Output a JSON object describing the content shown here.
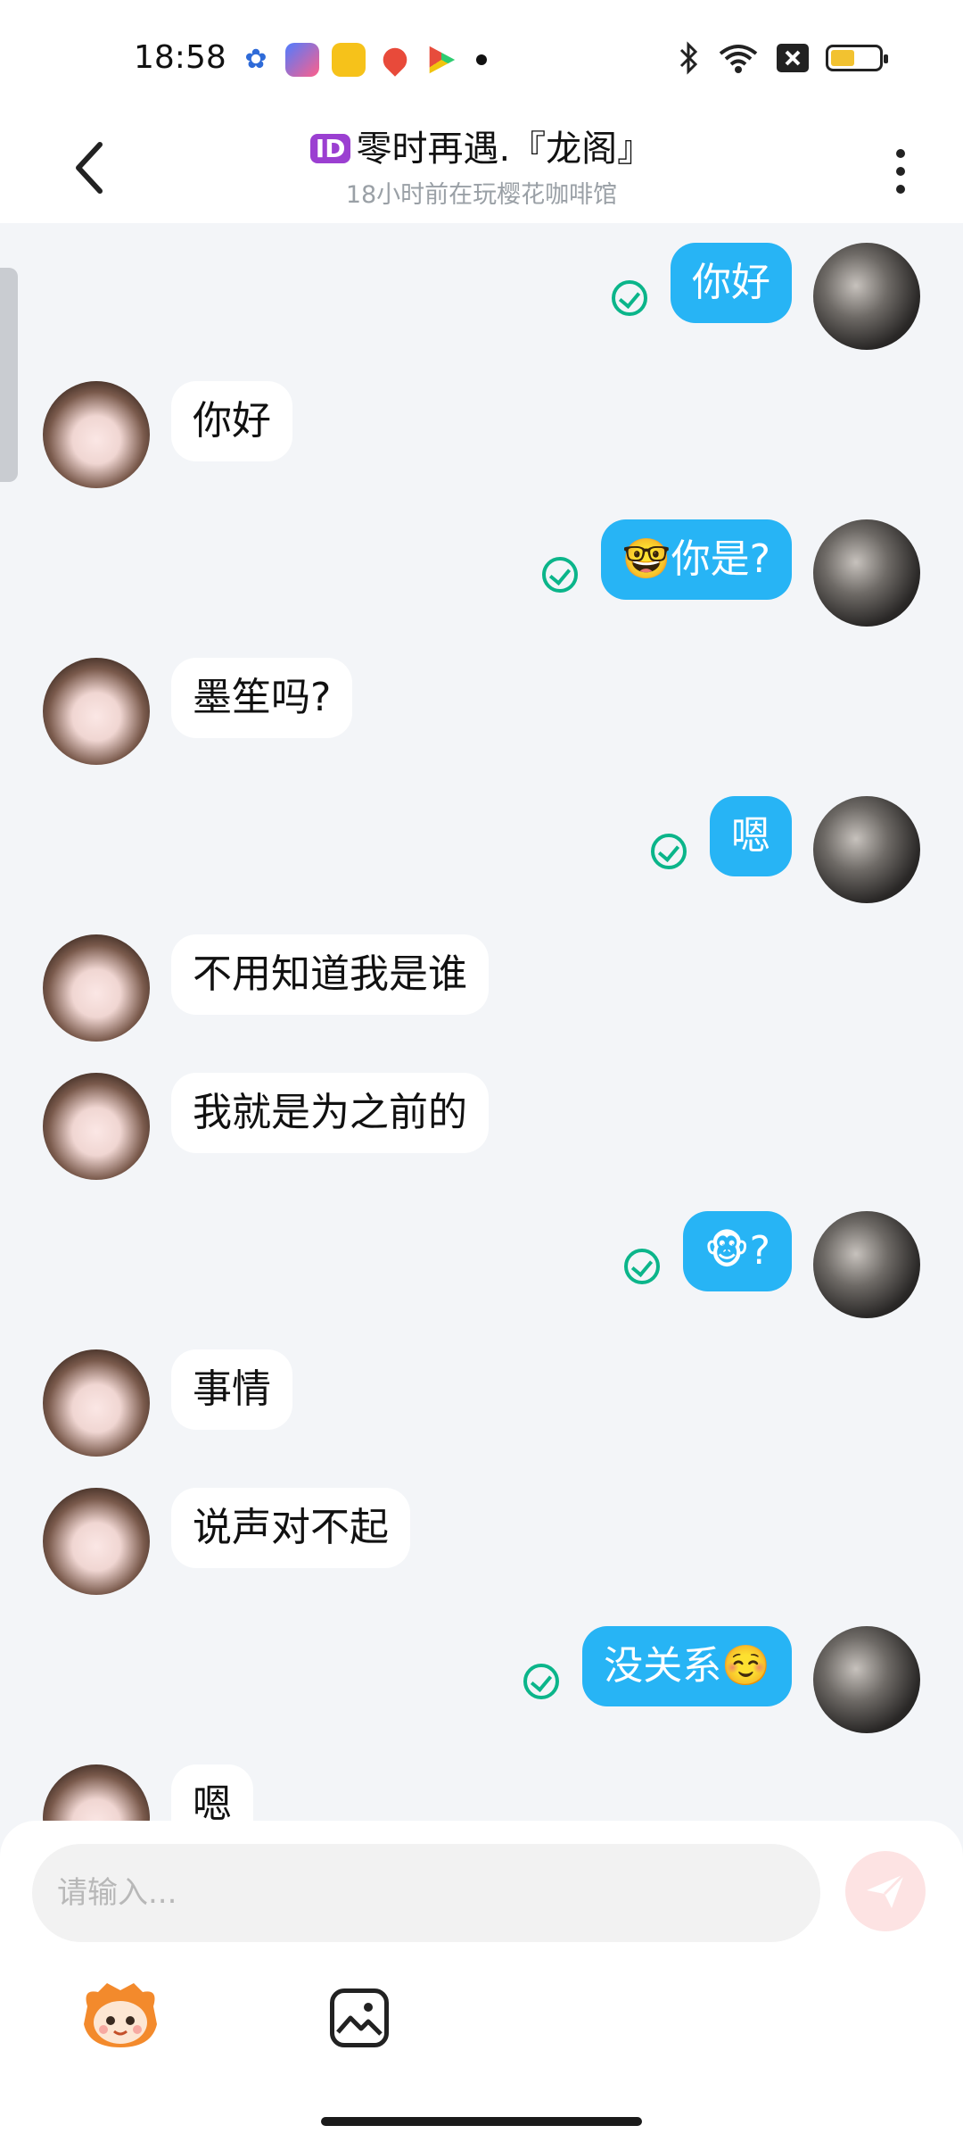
{
  "status_bar": {
    "time": "18:58"
  },
  "header": {
    "badge": "ID",
    "title": "零时再遇.『龙阁』",
    "subtitle": "18小时前在玩樱花咖啡馆"
  },
  "messages": [
    {
      "side": "me",
      "text": "你好",
      "read": true
    },
    {
      "side": "them",
      "text": "你好"
    },
    {
      "side": "me",
      "text": "🤓你是?",
      "read": true
    },
    {
      "side": "them",
      "text": "墨笙吗?"
    },
    {
      "side": "me",
      "text": "嗯",
      "read": true
    },
    {
      "side": "them",
      "text": "不用知道我是谁"
    },
    {
      "side": "them",
      "text": "我就是为之前的"
    },
    {
      "side": "me",
      "text": "🐵?",
      "read": true,
      "is_sticker": true
    },
    {
      "side": "them",
      "text": "事情"
    },
    {
      "side": "them",
      "text": "说声对不起"
    },
    {
      "side": "me",
      "text": "没关系☺️",
      "read": true
    },
    {
      "side": "them",
      "text": "嗯"
    }
  ],
  "composer": {
    "placeholder": "请输入...",
    "value": ""
  },
  "colors": {
    "bubble_me": "#27b4f5",
    "bubble_them": "#ffffff",
    "read_check": "#0bb58a",
    "background": "#f3f5f8"
  },
  "icons": [
    "back-arrow-icon",
    "more-vertical-icon",
    "read-check-icon",
    "send-icon",
    "mascot-emoji-icon",
    "image-icon"
  ]
}
